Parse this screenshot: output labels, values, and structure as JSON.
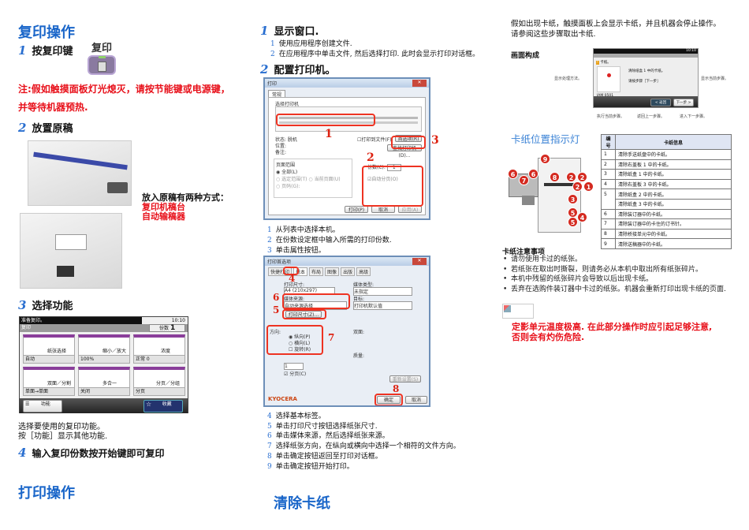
{
  "copy": {
    "title": "复印操作",
    "step1": {
      "num": "1",
      "label": "按复印键"
    },
    "copy_key_label": "复印",
    "note_line1": "注:假如触摸面板灯光熄灭，请按节能键或电源键，",
    "note_line2": "并等待机器预热.",
    "step2": {
      "num": "2",
      "label": "放置原稿"
    },
    "place_intro": "放入原稿有两种方式：",
    "place_method1": "复印机稿台",
    "place_method2": "自动输稿器",
    "step3": {
      "num": "3",
      "label": "选择功能"
    },
    "panel": {
      "status": "准备复印。",
      "time": "10:10",
      "mode": "复印",
      "copies_label": "份数",
      "copies": "1",
      "tiles": [
        {
          "label": "纸张选择",
          "value": "自动"
        },
        {
          "label": "缩小／放大",
          "value": "100%"
        },
        {
          "label": "浓度",
          "value": "正常 0"
        },
        {
          "label": "双面／分割",
          "value": "单面→单面"
        },
        {
          "label": "多合一",
          "value": "关闭"
        },
        {
          "label": "分页／分组",
          "value": "分页"
        }
      ],
      "functions_btn": "功能",
      "favorites_btn": "收藏"
    },
    "desc1": "选择要使用的复印功能。",
    "desc2": "按［功能］显示其他功能.",
    "step4": {
      "num": "4",
      "label": "输入复印份数按开始键即可复印"
    }
  },
  "print": {
    "title": "打印操作",
    "step1": {
      "num": "1",
      "label": "显示窗口."
    },
    "step1_subs": [
      {
        "n": "1",
        "t": "使用应用程序创建文件."
      },
      {
        "n": "2",
        "t": "在应用程序中单击文件, 然后选择打印. 此时会显示打印对话框。"
      }
    ],
    "step2": {
      "num": "2",
      "label": "配置打印机。"
    },
    "dialog1": {
      "title": "打印",
      "tab": "常规",
      "group": "选择打印机",
      "status": "状态:  脱机",
      "location": "位置:",
      "comment": "备注:",
      "print_to_file": "打印到文件(F)",
      "prefs": "首选项(R)",
      "find": "查找打印机(D)...",
      "range": "页面范围",
      "all": "全部(L)",
      "selection": "选定范围(T)",
      "current": "当前页面(U)",
      "pages": "页码(G):",
      "copies": "份数(C):",
      "copies_val": "1",
      "collate": "自动分页(O)",
      "print": "打印(P)",
      "cancel": "取消",
      "apply": "应用(A)"
    },
    "step2_subs": [
      {
        "n": "1",
        "t": "从列表中选择本机。"
      },
      {
        "n": "2",
        "t": "在份数设定框中输入所需的打印份数."
      },
      {
        "n": "3",
        "t": "单击属性按钮。"
      }
    ],
    "dialog2": {
      "title": "打印首选项",
      "tabs": [
        "快捷打印",
        "基本",
        "布局",
        "图像",
        "出版",
        "高级"
      ],
      "print_size": "打印尺寸:",
      "size_val": "A4 (210x297)",
      "media_type": "媒体类型:",
      "media_type_val": "未指定",
      "source": "媒体来源:",
      "source_val": "自动来源选择",
      "dest": "目标:",
      "dest_val": "打印机默认值",
      "size_btn": "打印尺寸(Z)...",
      "orientation": "方向:",
      "portrait": "纵向(P)",
      "landscape": "横向(L)",
      "rotate": "旋转(R)",
      "duplex": "双面:",
      "quality": "质量:",
      "copies_val": "1",
      "collate": "分页(C)",
      "reset": "重新设置(S)",
      "brand": "KYOCERA",
      "ok": "确定",
      "cancel": "取消"
    },
    "markers": [
      "1",
      "2",
      "3",
      "4",
      "5",
      "6",
      "7",
      "8"
    ],
    "steps_after": [
      {
        "n": "4",
        "t": "选择基本标签。"
      },
      {
        "n": "5",
        "t": "单击打印尺寸按钮选择纸张尺寸."
      },
      {
        "n": "6",
        "t": "单击媒体来源，然后选择纸张来源。"
      },
      {
        "n": "7",
        "t": "选择纸张方向，在纵向或横向中选择一个相符的文件方向。"
      },
      {
        "n": "8",
        "t": "单击确定按钮返回至打印对话框。"
      },
      {
        "n": "9",
        "t": "单击确定按钮开始打印。"
      }
    ]
  },
  "jam": {
    "title": "清除卡纸",
    "intro1": "假如出现卡纸，触摸面板上会显示卡纸，并且机器会停止操作。",
    "intro2": "请参阅这些步骤取出卡纸.",
    "screen_title": "画面构成",
    "screen": {
      "time": "10:10",
      "jam": "卡纸。",
      "line1": "清除纸盒 1 中的卡纸。",
      "line2": "请按步骤［下一步］",
      "code": "JAM 0501",
      "back": "< 返回",
      "next": "下一步 >",
      "callouts": {
        "method": "显示处理方法。",
        "current": "显示当前步骤。",
        "exec": "执行当前步骤。",
        "back": "返回上一步骤。",
        "next": "进入下一步骤。"
      }
    },
    "indicator_title": "卡纸位置指示灯",
    "table": {
      "headers": [
        "编号",
        "卡纸信息"
      ],
      "rows": [
        [
          "1",
          "清除手送纸盘中的卡纸。"
        ],
        [
          "2",
          "清除右盖板 1 中的卡纸。"
        ],
        [
          "3",
          "清除纸盒 1 中的卡纸。"
        ],
        [
          "4",
          "清除右盖板 3 中的卡纸。"
        ],
        [
          "5",
          "清除纸盒 2 中的卡纸。"
        ],
        [
          "",
          "清除纸盒 3 中的卡纸。"
        ],
        [
          "6",
          "清除装订器中的卡纸。"
        ],
        [
          "7",
          "清除装订器中的卡住的订书针。"
        ],
        [
          "8",
          "清除桥接单元中的卡纸。"
        ],
        [
          "9",
          "清除送稿器中的卡纸。"
        ]
      ]
    },
    "notes_title": "卡纸注意事项",
    "notes": [
      "请勿使用卡过的纸张。",
      "若纸张在取出时撕裂，则请务必从本机中取出所有纸张碎片。",
      "本机中残留的纸张碎片会导致以后出现卡纸。",
      "丢弃在选购件装订器中卡过的纸张。机器会重新打印出现卡纸的页面."
    ],
    "warning1": "定影单元温度极高. 在此部分操作时应引起足够注意,",
    "warning2": "否则会有灼伤危险."
  },
  "colors": {
    "heading": "#1a66c9",
    "warning": "#e8101a",
    "accent": "#8a3e9a"
  }
}
